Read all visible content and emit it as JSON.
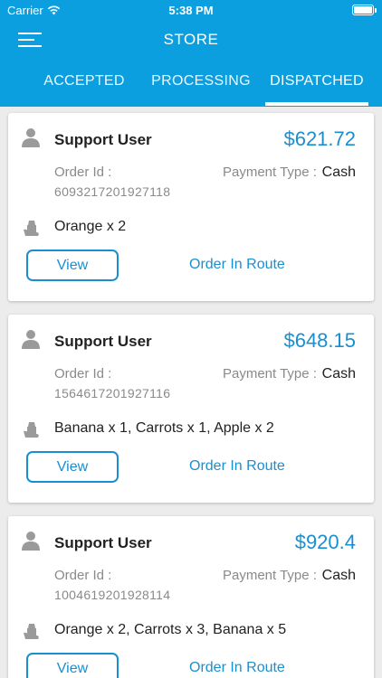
{
  "status_bar": {
    "carrier": "Carrier",
    "time": "5:38 PM"
  },
  "header": {
    "title": "STORE"
  },
  "tabs": [
    {
      "label": "ACCEPTED"
    },
    {
      "label": "PROCESSING"
    },
    {
      "label": "DISPATCHED"
    }
  ],
  "labels": {
    "order_id": "Order Id :",
    "payment_type": "Payment Type :"
  },
  "orders": [
    {
      "user": "Support User",
      "amount": "$621.72",
      "order_id": "6093217201927118",
      "payment": "Cash",
      "items": "Orange x 2",
      "view_label": "View",
      "status": "Order In Route"
    },
    {
      "user": "Support User",
      "amount": "$648.15",
      "order_id": "1564617201927116",
      "payment": "Cash",
      "items": "Banana x 1, Carrots x 1, Apple x 2",
      "view_label": "View",
      "status": "Order In Route"
    },
    {
      "user": "Support User",
      "amount": "$920.4",
      "order_id": "1004619201928114",
      "payment": "Cash",
      "items": "Orange x 2, Carrots x 3, Banana x 5",
      "view_label": "View",
      "status": "Order In Route"
    }
  ],
  "colors": {
    "header": "#0b9fdf",
    "accent": "#1a8fd0"
  }
}
